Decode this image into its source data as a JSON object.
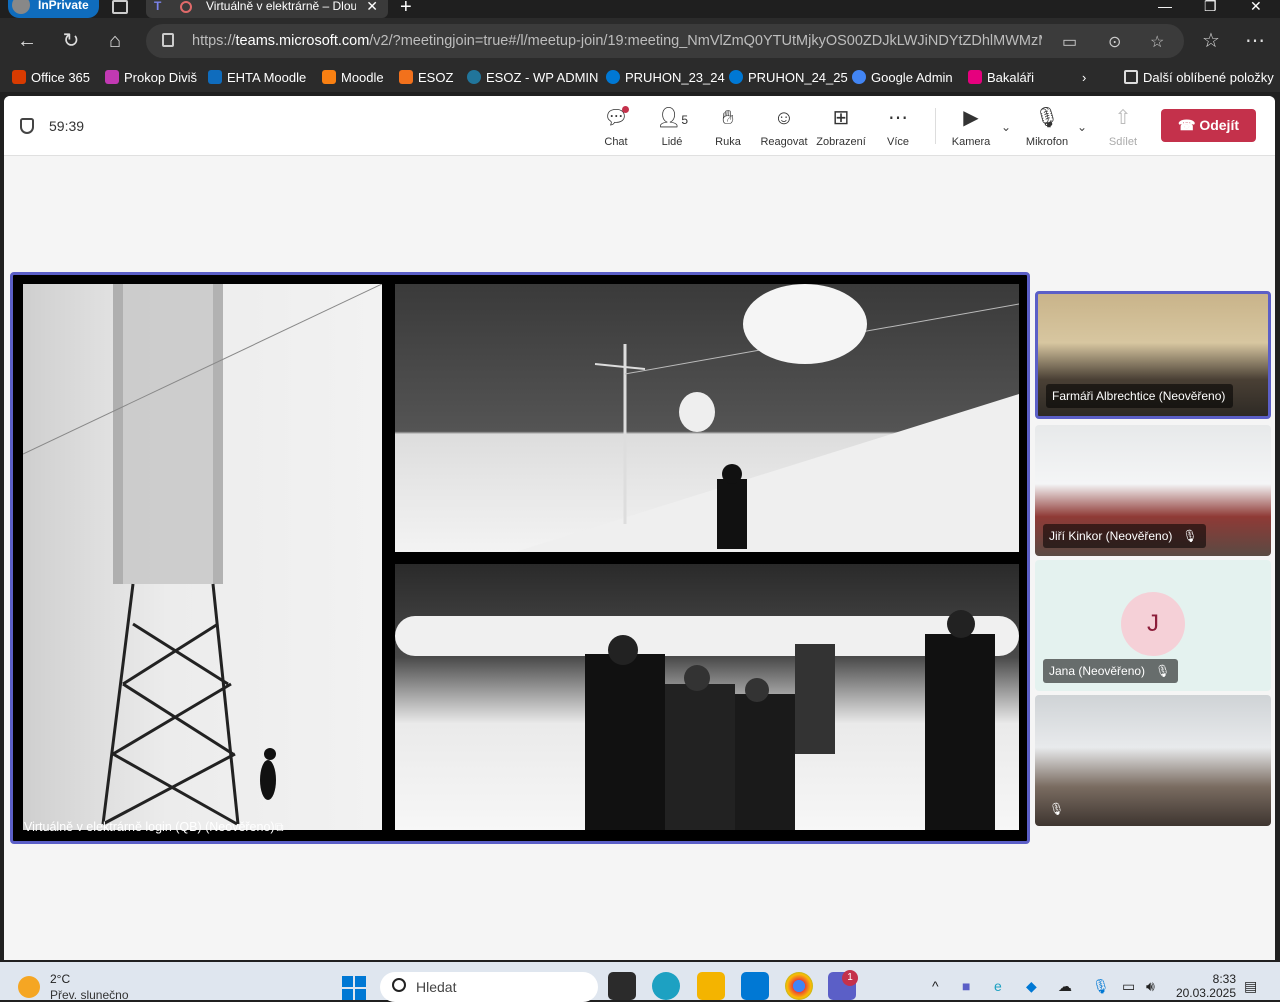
{
  "browser": {
    "inprivate_label": "InPrivate",
    "tab_title": "Virtuálně v elektrárně – Dlouhodobé",
    "url_prefix": "https://",
    "url_host": "teams.microsoft.com",
    "url_path": "/v2/?meetingjoin=true#/l/meetup-join/19:meeting_NmVlZmQ0YTUtMjkyOS00ZDJkLWJiNDYtZDhlMWMzM..."
  },
  "bookmarks": [
    {
      "label": "Office 365",
      "color": "#d83b01"
    },
    {
      "label": "Prokop Diviš",
      "color": "#c239b3"
    },
    {
      "label": "EHTA Moodle",
      "color": "#0f6cbd"
    },
    {
      "label": "Moodle",
      "color": "#f98012"
    },
    {
      "label": "ESOZ",
      "color": "#f2711c"
    },
    {
      "label": "ESOZ - WP ADMIN",
      "color": "#21759b"
    },
    {
      "label": "PRUHON_23_24",
      "color": "#0078d4"
    },
    {
      "label": "PRUHON_24_25",
      "color": "#0078d4"
    },
    {
      "label": "Google Admin",
      "color": "#4285f4"
    },
    {
      "label": "Bakaláři",
      "color": "#e6007e"
    }
  ],
  "bookmarks_more": "Další oblíbené položky",
  "meeting": {
    "timer": "59:39",
    "controls": {
      "chat": "Chat",
      "people": "Lidé",
      "people_count": "5",
      "hand": "Ruka",
      "react": "Reagovat",
      "view": "Zobrazení",
      "more": "Více",
      "camera": "Kamera",
      "mic": "Mikrofon",
      "share": "Sdílet"
    },
    "leave": "Odejít",
    "stage_label": "Virtuálně v elektrárně login (QB) (Neověřeno)",
    "participants": [
      {
        "name": "Farmáři Albrechtice (Neověřeno)",
        "muted": false
      },
      {
        "name": "Jiří Kinkor (Neověřeno)",
        "muted": true
      },
      {
        "name": "Jana (Neověřeno)",
        "muted": true,
        "initial": "J"
      },
      {
        "name": "",
        "muted": true
      }
    ]
  },
  "taskbar": {
    "temp": "2°C",
    "weather": "Přev. slunečno",
    "search_placeholder": "Hledat",
    "teams_badge": "1",
    "time": "8:33",
    "date": "20.03.2025"
  },
  "colors": {
    "accent": "#5b5fc7",
    "leave": "#c4314b"
  }
}
